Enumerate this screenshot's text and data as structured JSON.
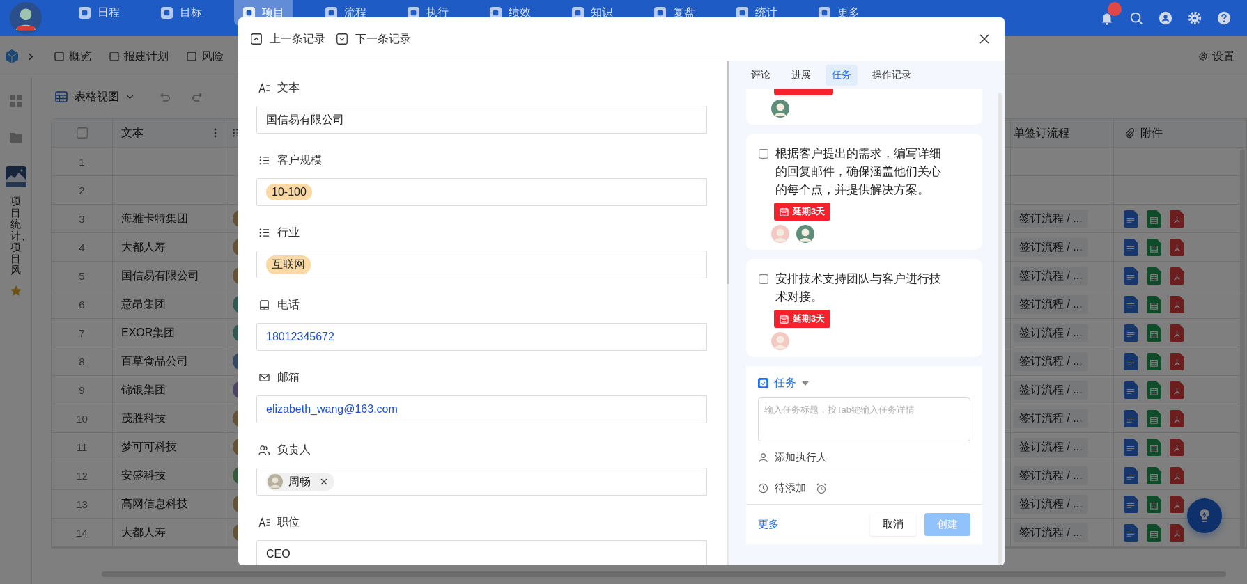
{
  "top_nav": {
    "items": [
      {
        "label": "日程",
        "selected": false
      },
      {
        "label": "目标",
        "selected": false
      },
      {
        "label": "项目",
        "selected": true
      },
      {
        "label": "流程",
        "selected": false
      },
      {
        "label": "执行",
        "selected": false
      },
      {
        "label": "绩效",
        "selected": false
      },
      {
        "label": "知识",
        "selected": false
      },
      {
        "label": "复盘",
        "selected": false
      },
      {
        "label": "统计",
        "selected": false
      },
      {
        "label": "更多",
        "selected": false
      }
    ]
  },
  "sub_nav": {
    "items": [
      "概览",
      "报建计划",
      "风险"
    ],
    "settings": "设置"
  },
  "sidebar": {
    "vertical_title": "项目统计、项目风"
  },
  "toolbar": {
    "view": "表格视图"
  },
  "table": {
    "select_all": {
      "checked": false
    },
    "columns": [
      {
        "label": "文本"
      },
      {
        "label": "单签订流程"
      },
      {
        "label": "附件"
      }
    ],
    "rows": [
      {
        "number": "1",
        "has_attachments": false
      },
      {
        "number": "2",
        "has_attachments": false
      },
      {
        "number": "3",
        "text": "海雅卡特集团",
        "avatar": {
          "kind": "beige"
        },
        "flow": "签订流程 / ...",
        "has_attachments": true
      },
      {
        "number": "4",
        "text": "大都人寿",
        "avatar": {
          "kind": "beige"
        },
        "flow": "签订流程 / ...",
        "has_attachments": true
      },
      {
        "number": "5",
        "text": "国信易有限公司",
        "avatar": {
          "kind": "beige"
        },
        "flow": "签订流程 / ...",
        "has_attachments": true
      },
      {
        "number": "6",
        "text": "意昂集团",
        "avatar": {
          "kind": "teal"
        },
        "flow": "签订流程 / ...",
        "has_attachments": true
      },
      {
        "number": "7",
        "text": "EXOR集团",
        "avatar": {
          "kind": "teal"
        },
        "flow": "签订流程 / ...",
        "has_attachments": true
      },
      {
        "number": "8",
        "text": "百草食品公司",
        "avatar": {
          "kind": "blue"
        },
        "flow": "签订流程 / ...",
        "has_attachments": true
      },
      {
        "number": "9",
        "text": "锦银集团",
        "avatar": {
          "kind": "purple"
        },
        "flow": "签订流程 / ...",
        "has_attachments": true
      },
      {
        "number": "10",
        "text": "茂胜科技",
        "avatar": {
          "kind": "beige"
        },
        "flow": "签订流程 / ...",
        "has_attachments": true
      },
      {
        "number": "11",
        "text": "梦可可科技",
        "avatar": {
          "kind": "beige"
        },
        "flow": "签订流程 / ...",
        "has_attachments": true
      },
      {
        "number": "12",
        "text": "安盛科技",
        "avatar": {
          "kind": "green"
        },
        "flow": "签订流程 / ...",
        "has_attachments": true
      },
      {
        "number": "13",
        "text": "高网信息科技",
        "avatar": {
          "kind": "beige"
        },
        "flow": "签订流程 / ...",
        "has_attachments": true
      },
      {
        "number": "14",
        "text": "大都人寿",
        "avatar": {
          "kind": "beige"
        },
        "flow": "签订流程 / ...",
        "has_attachments": true
      }
    ]
  },
  "modal": {
    "prev": "上一条记录",
    "next": "下一条记录",
    "fields": [
      {
        "kind": "text",
        "label": "文本",
        "value": "国信易有限公司"
      },
      {
        "kind": "select",
        "label": "客户规模",
        "tags": [
          "10-100"
        ]
      },
      {
        "kind": "select",
        "label": "行业",
        "tags": [
          "互联网"
        ]
      },
      {
        "kind": "phone",
        "label": "电话",
        "value": "18012345672"
      },
      {
        "kind": "email",
        "label": "邮箱",
        "value": "elizabeth_wang@163.com"
      },
      {
        "kind": "person",
        "label": "负责人",
        "people": [
          "周畅"
        ]
      },
      {
        "kind": "text",
        "label": "职位",
        "value": "CEO"
      }
    ],
    "tabs": [
      {
        "label": "评论",
        "selected": false
      },
      {
        "label": "进展",
        "selected": false
      },
      {
        "label": "任务",
        "selected": true
      },
      {
        "label": "操作记录",
        "selected": false
      }
    ],
    "tasks": [
      {
        "kind": "partial",
        "assignees": [
          {
            "kind": "robot"
          }
        ]
      },
      {
        "kind": "full",
        "checked": false,
        "title": "根据客户提出的需求，编写详细的回复邮件，确保涵盖他们关心的每个点，并提供解决方案。",
        "due": "延期3天",
        "overdue": true,
        "assignees": [
          {
            "kind": "girl"
          },
          {
            "kind": "robot"
          }
        ]
      },
      {
        "kind": "full",
        "checked": false,
        "title": "安排技术支持团队与客户进行技术对接。",
        "due": "延期3天",
        "overdue": true,
        "assignees": [
          {
            "kind": "girl"
          }
        ]
      }
    ],
    "composer": {
      "type_label": "任务",
      "placeholder": "输入任务标题，按Tab键输入任务详情",
      "assignee_hint": "添加执行人",
      "due_hint": "待添加",
      "more": "更多",
      "cancel": "取消",
      "create": "创建",
      "create_disabled": true
    }
  }
}
